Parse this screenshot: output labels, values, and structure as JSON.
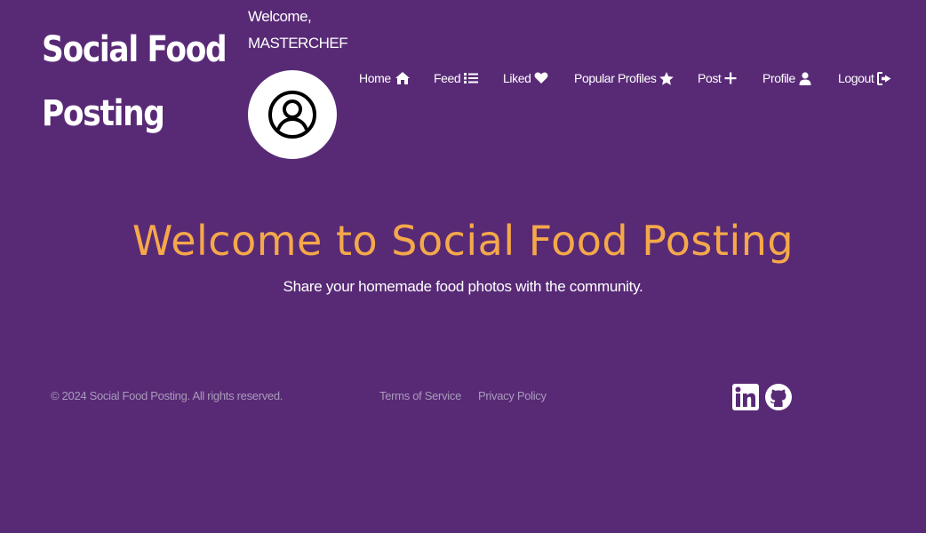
{
  "brand": {
    "line1": "Social Food",
    "line2": "Posting"
  },
  "user": {
    "welcome": "Welcome,",
    "name": "MASTERCHEF"
  },
  "nav": [
    {
      "label": "Home",
      "icon": "home-icon"
    },
    {
      "label": "Feed",
      "icon": "list-icon"
    },
    {
      "label": "Liked",
      "icon": "heart-icon"
    },
    {
      "label": "Popular Profiles",
      "icon": "star-icon"
    },
    {
      "label": "Post",
      "icon": "plus-icon"
    },
    {
      "label": "Profile",
      "icon": "user-icon"
    },
    {
      "label": "Logout",
      "icon": "logout-icon"
    }
  ],
  "hero": {
    "title": "Welcome to Social Food Posting",
    "subtitle": "Share your homemade food photos with the community."
  },
  "footer": {
    "copyright": "© 2024 Social Food Posting. All rights reserved.",
    "links": [
      "Terms of Service",
      "Privacy Policy"
    ],
    "social": [
      "linkedin-icon",
      "github-icon"
    ]
  },
  "colors": {
    "background": "#582a76",
    "accent": "#f5a84a",
    "muted": "#a99bb9"
  }
}
